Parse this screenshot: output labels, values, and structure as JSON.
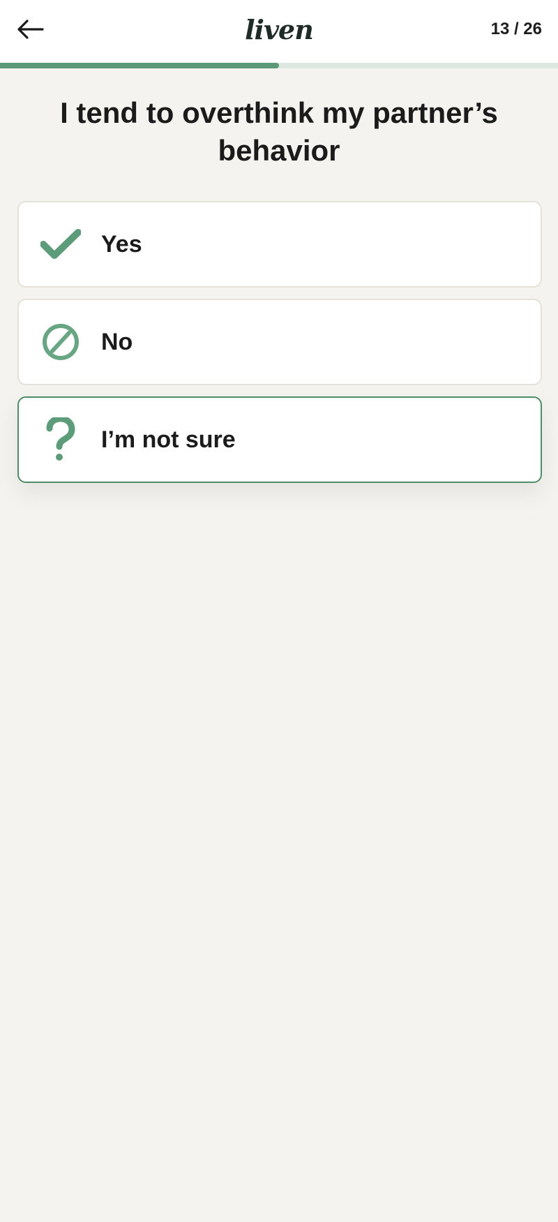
{
  "header": {
    "logo_text": "liven",
    "step_counter": "13 / 26"
  },
  "progress": {
    "current": 13,
    "total": 26,
    "fraction": 0.5,
    "fill_color": "#5a9a76",
    "track_color": "#dde7e1"
  },
  "question": {
    "title": "I tend to overthink my partner’s behavior"
  },
  "options": [
    {
      "label": "Yes",
      "icon": "check-icon",
      "selected": false
    },
    {
      "label": "No",
      "icon": "prohibited-icon",
      "selected": false
    },
    {
      "label": "I’m not sure",
      "icon": "question-mark-icon",
      "selected": true
    }
  ],
  "colors": {
    "accent": "#5a9a76",
    "background": "#f4f3ef",
    "card": "#ffffff",
    "selected_border": "#4f8c69"
  }
}
